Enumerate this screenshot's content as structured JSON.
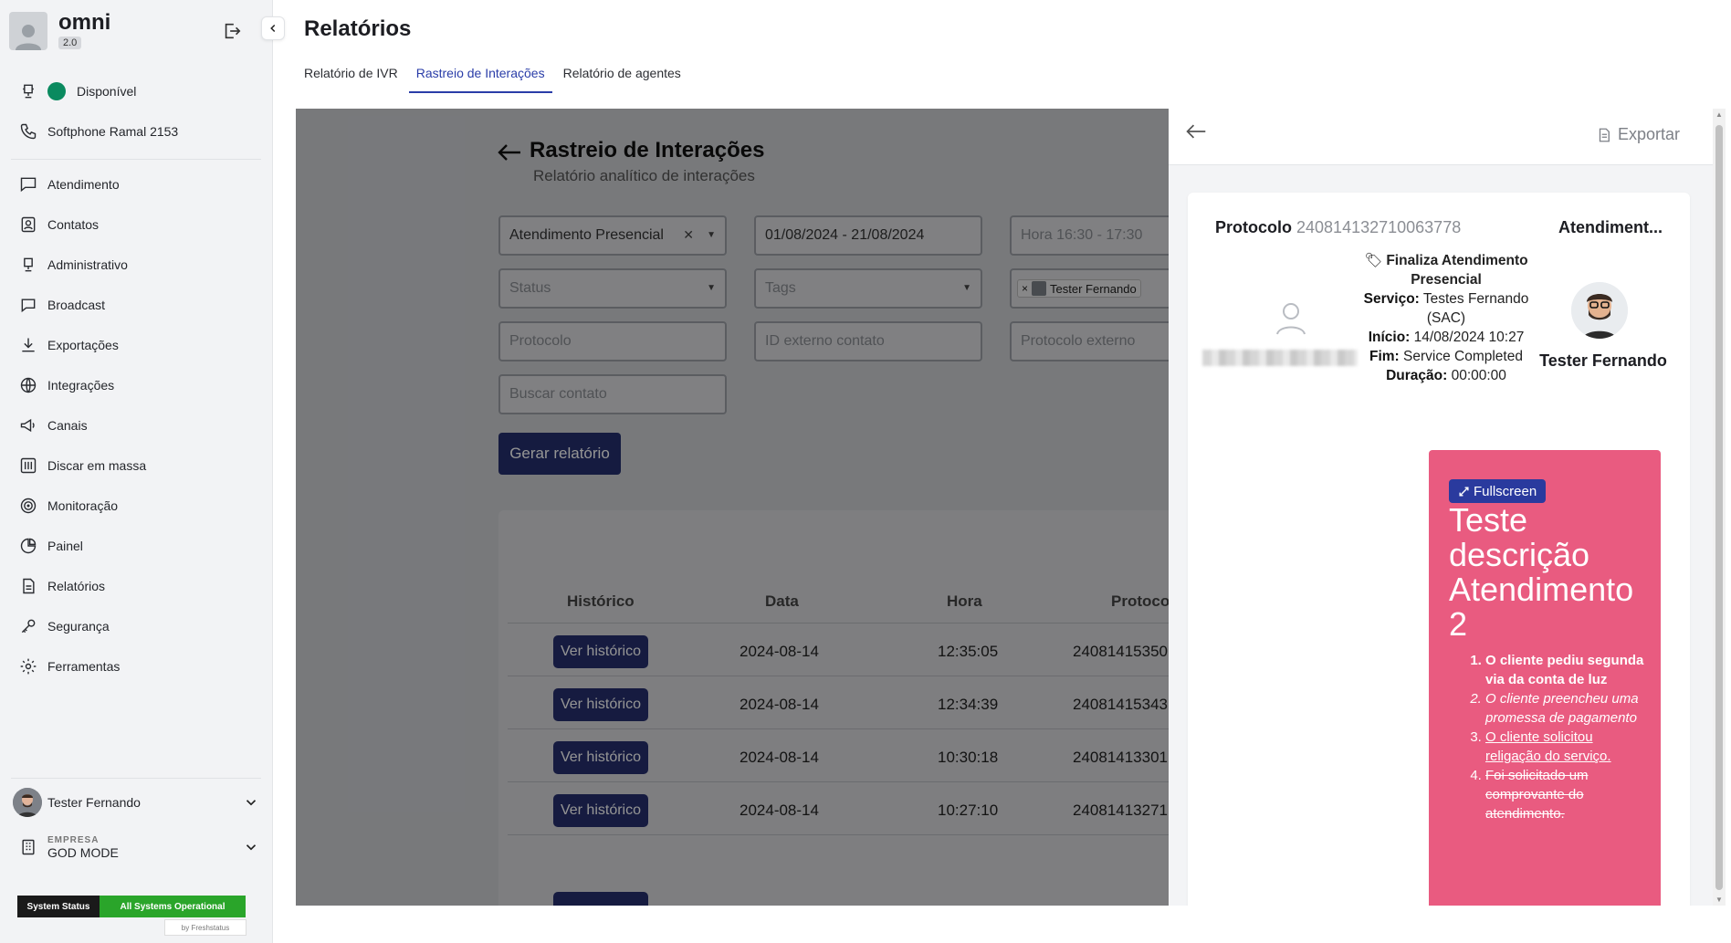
{
  "app": {
    "name": "omni",
    "version": "2.0"
  },
  "sidebar": {
    "status": {
      "label": "Disponível",
      "color": "#0a8a5f"
    },
    "softphone": "Softphone Ramal 2153",
    "items": [
      {
        "label": "Atendimento",
        "icon": "chat-icon"
      },
      {
        "label": "Contatos",
        "icon": "contacts-icon"
      },
      {
        "label": "Administrativo",
        "icon": "admin-icon"
      },
      {
        "label": "Broadcast",
        "icon": "broadcast-icon"
      },
      {
        "label": "Exportações",
        "icon": "download-icon"
      },
      {
        "label": "Integrações",
        "icon": "integrations-icon"
      },
      {
        "label": "Canais",
        "icon": "megaphone-icon"
      },
      {
        "label": "Discar em massa",
        "icon": "mass-dial-icon"
      },
      {
        "label": "Monitoração",
        "icon": "target-icon"
      },
      {
        "label": "Painel",
        "icon": "pie-chart-icon"
      },
      {
        "label": "Relatórios",
        "icon": "report-icon"
      },
      {
        "label": "Segurança",
        "icon": "key-icon"
      },
      {
        "label": "Ferramentas",
        "icon": "gear-icon"
      }
    ],
    "user": "Tester Fernando",
    "company_label": "EMPRESA",
    "company": "GOD MODE",
    "system_status": {
      "left": "System Status",
      "right": "All Systems Operational",
      "by": "by Freshstatus"
    }
  },
  "header": {
    "title": "Relatórios",
    "tabs": [
      {
        "label": "Relatório de IVR"
      },
      {
        "label": "Rastreio de Interações"
      },
      {
        "label": "Relatório de agentes"
      }
    ]
  },
  "report": {
    "title": "Rastreio de Interações",
    "subtitle": "Relatório analítico de interações",
    "filters": {
      "service": "Atendimento Presencial",
      "date_range": "01/08/2024 - 21/08/2024",
      "hour_placeholder": "Hora 16:30 - 17:30",
      "status_placeholder": "Status",
      "tags_placeholder": "Tags",
      "agent_chip": "Tester Fernando",
      "protocol_placeholder": "Protocolo",
      "external_contact_placeholder": "ID externo contato",
      "external_protocol_placeholder": "Protocolo externo",
      "search_contact_placeholder": "Buscar contato"
    },
    "generate_button": "Gerar relatório",
    "table": {
      "headers": [
        "Histórico",
        "Data",
        "Hora",
        "Protoco"
      ],
      "history_button": "Ver histórico",
      "rows": [
        {
          "date": "2024-08-14",
          "time": "12:35:05",
          "protocol": "24081415350"
        },
        {
          "date": "2024-08-14",
          "time": "12:34:39",
          "protocol": "24081415343"
        },
        {
          "date": "2024-08-14",
          "time": "10:30:18",
          "protocol": "24081413301"
        },
        {
          "date": "2024-08-14",
          "time": "10:27:10",
          "protocol": "24081413271"
        }
      ]
    }
  },
  "drawer": {
    "export_label": "Exportar",
    "protocol_label": "Protocolo",
    "protocol_value": "2408141327100637​78",
    "attendance_label": "Atendiment...",
    "finalize_label": "Finaliza Atendimento Presencial",
    "service_label": "Serviço:",
    "service_value": "Testes Fernando (SAC)",
    "start_label": "Início:",
    "start_value": "14/08/2024 10:27",
    "end_label": "Fim:",
    "end_value": "Service Completed",
    "duration_label": "Duração:",
    "duration_value": "00:00:00",
    "agent_name": "Tester Fernando",
    "note": {
      "fullscreen_label": "Fullscreen",
      "title": "Teste descrição Atendimento 2",
      "items": [
        "O cliente pediu segunda via da conta de luz",
        "O cliente preencheu uma promessa de pagamento",
        "O cliente solicitou religação do serviço.",
        "Foi solicitado um comprovante do atendimento."
      ],
      "bg_color": "#e95b80"
    }
  }
}
